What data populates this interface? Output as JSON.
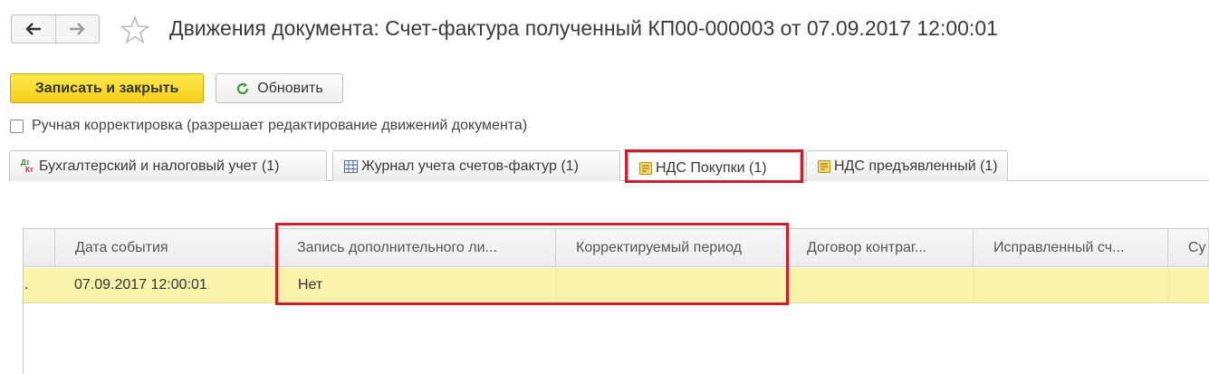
{
  "window": {
    "title": "Движения документа: Счет-фактура полученный КП00-000003 от 07.09.2017 12:00:01",
    "back_icon": "arrow-left-icon",
    "forward_icon": "arrow-right-icon",
    "favorite_icon": "star-outline-icon"
  },
  "toolbar": {
    "save_close_label": "Записать и закрыть",
    "refresh_label": "Обновить",
    "refresh_icon": "refresh-icon"
  },
  "manual_edit": {
    "label": "Ручная корректировка (разрешает редактирование движений документа)",
    "checked": false
  },
  "tabs": [
    {
      "label": "Бухгалтерский и налоговый учет (1)",
      "icon": "dt-kt-icon",
      "active": false
    },
    {
      "label": "Журнал учета счетов-фактур (1)",
      "icon": "table-icon",
      "active": false
    },
    {
      "label": "НДС Покупки (1)",
      "icon": "register-icon",
      "active": true
    },
    {
      "label": "НДС предъявленный (1)",
      "icon": "register-icon",
      "active": false
    }
  ],
  "table": {
    "columns": [
      "",
      "Дата события",
      "Запись дополнительного ли...",
      "Корректируемый период",
      "Договор контраг...",
      "Исправленный сч...",
      "Су"
    ],
    "rows": [
      {
        "marker": ".",
        "cells": [
          "07.09.2017 12:00:01",
          "Нет",
          "",
          "",
          "",
          ""
        ]
      }
    ]
  },
  "colors": {
    "highlight": "#cc1f2b",
    "selected_row": "#fbf3a9",
    "primary_button": "#f5cf1c"
  }
}
